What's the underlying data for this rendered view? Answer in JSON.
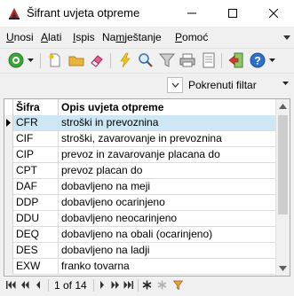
{
  "window": {
    "title": "Šifrant uvjeta otpreme"
  },
  "menu": {
    "items": [
      "Unosi",
      "Alati",
      "Ispis",
      "Namještanje",
      "Pomoć"
    ]
  },
  "toolbar": {
    "icons": [
      "go-icon",
      "dropdown-arrow-icon",
      "new-record-icon",
      "open-folder-icon",
      "eraser-icon",
      "lightning-icon",
      "search-icon",
      "filter-icon",
      "print-icon",
      "print-preview-icon",
      "exit-icon",
      "help-icon"
    ]
  },
  "filter": {
    "label": "Pokrenuti filtar"
  },
  "grid": {
    "columns": [
      "Šifra",
      "Opis uvjeta otpreme"
    ],
    "rows": [
      {
        "code": "CFR",
        "desc": "stroški in prevoznina"
      },
      {
        "code": "CIF",
        "desc": "stroški, zavarovanje in prevoznina"
      },
      {
        "code": "CIP",
        "desc": "prevoz in zavarovanje placana do"
      },
      {
        "code": "CPT",
        "desc": "prevoz placan do"
      },
      {
        "code": "DAF",
        "desc": "dobavljeno na meji"
      },
      {
        "code": "DDP",
        "desc": "dobavljeno ocarinjeno"
      },
      {
        "code": "DDU",
        "desc": "dobavljeno neocarinjeno"
      },
      {
        "code": "DEQ",
        "desc": "dobavljeno na obali (ocarinjeno)"
      },
      {
        "code": "DES",
        "desc": "dobavljeno na ladji"
      },
      {
        "code": "EXW",
        "desc": "franko tovarna"
      }
    ],
    "selected_index": 0
  },
  "navigator": {
    "position": "1 of 14"
  },
  "colors": {
    "selection": "#cde7f5",
    "accent_green": "#3aa53a",
    "help_blue": "#2d6fc9"
  }
}
